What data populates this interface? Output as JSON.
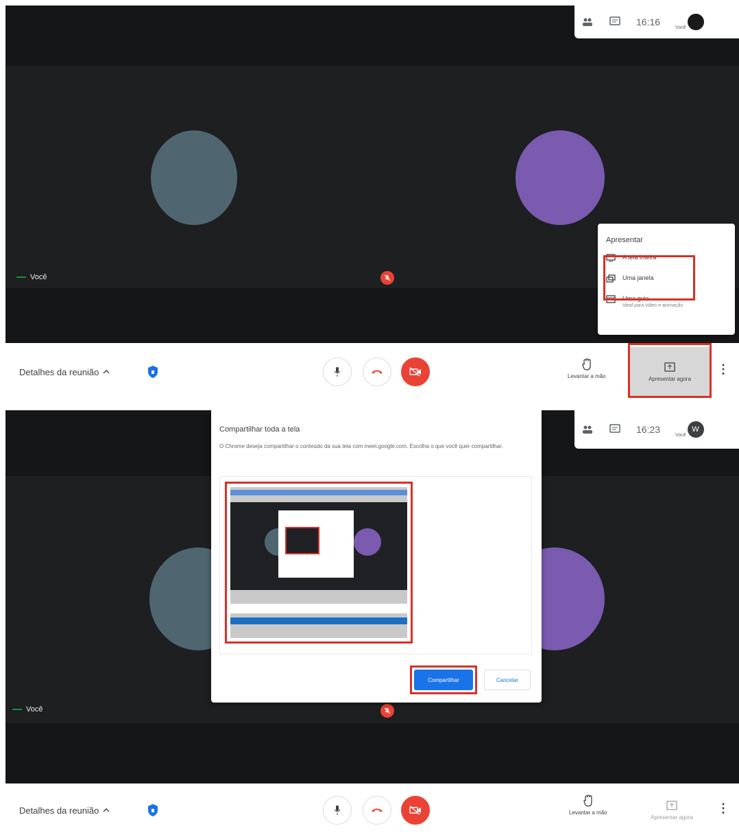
{
  "panel1": {
    "topbar": {
      "time": "16:16",
      "you_label": "Você"
    },
    "you_label": "Você",
    "controls": {
      "details": "Detalhes da reunião",
      "raise_hand": "Levantar a mão",
      "present_now": "Apresentar agora"
    },
    "present_menu": {
      "title": "Apresentar",
      "items": [
        {
          "label": "A tela inteira",
          "sub": ""
        },
        {
          "label": "Uma janela",
          "sub": ""
        },
        {
          "label": "Uma guia",
          "sub": "Ideal para vídeo e animação"
        }
      ]
    }
  },
  "panel2": {
    "topbar": {
      "time": "16:23",
      "you_label": "Você",
      "avatar_initial": "W"
    },
    "you_label": "Você",
    "controls": {
      "details": "Detalhes da reunião",
      "raise_hand": "Levantar a mão",
      "present_now": "Apresentar agora"
    },
    "share_dialog": {
      "title": "Compartilhar toda a tela",
      "message": "O Chrome deseja compartilhar o conteúdo da sua tela com meet.google.com. Escolha o que você quer compartilhar.",
      "share_label": "Compartilhar",
      "cancel_label": "Cancelar"
    }
  },
  "colors": {
    "tile_gray": "#4f6670",
    "tile_purple": "#7a5bb0",
    "hangup_red": "#ea4335",
    "accent_blue": "#1a73e8",
    "highlight_red": "#d93025"
  }
}
